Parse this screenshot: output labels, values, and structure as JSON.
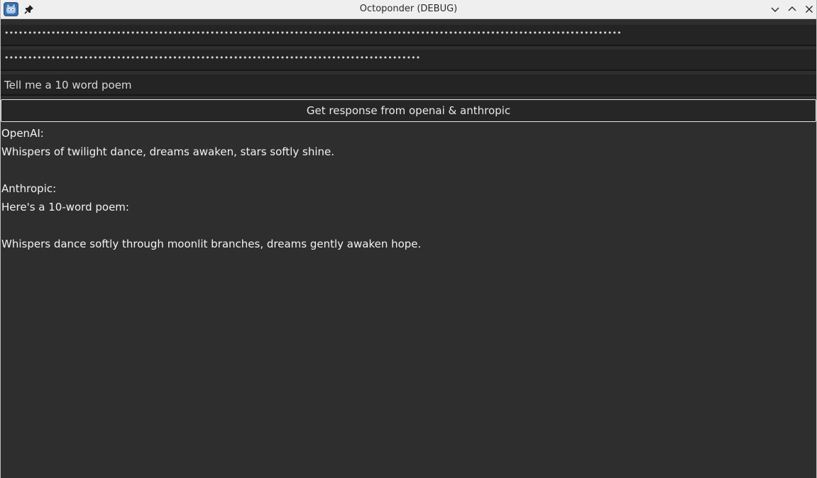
{
  "window": {
    "title": "Octoponder (DEBUG)"
  },
  "inputs": {
    "api_key_1_masked": "••••••••••••••••••••••••••••••••••••••••••••••••••••••••••••••••••••••••••••••••••••••••••••••••••••••••••••••••••••••••••••••••••••",
    "api_key_2_masked": "•••••••••••••••••••••••••••••••••••••••••••••••••••••••••••••••••••••••••••••••••••••••••",
    "prompt_value": "Tell me a 10 word poem"
  },
  "button": {
    "label": "Get response from openai & anthropic"
  },
  "output": {
    "openai_heading": "OpenAI:",
    "openai_text": "Whispers of twilight dance, dreams awaken, stars softly shine.",
    "anthropic_heading": "Anthropic:",
    "anthropic_intro": "Here's a 10-word poem:",
    "anthropic_text": "Whispers dance softly through moonlit branches, dreams gently awaken hope."
  },
  "icons": {
    "app": "godot-app-icon",
    "pin": "pin-icon",
    "minimize": "chevron-down-icon",
    "maximize": "chevron-up-icon",
    "close": "close-icon"
  },
  "colors": {
    "background": "#2e2e2e",
    "field_background": "#242424",
    "titlebar": "#efefef",
    "text": "#f2f2f2"
  }
}
